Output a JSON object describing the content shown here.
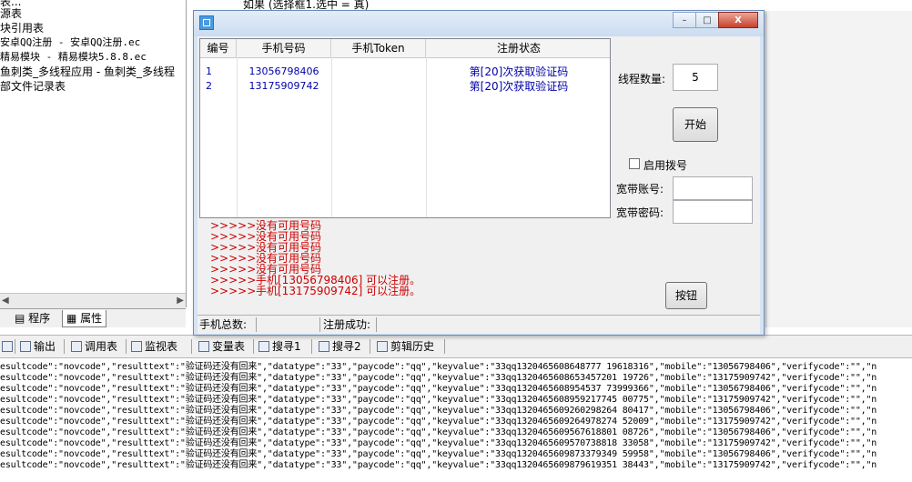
{
  "left_panel": {
    "tree_lines": [
      "表...",
      "源表",
      "块引用表",
      "安卓QQ注册 - 安卓QQ注册.ec",
      "精易模块 - 精易模块5.8.8.ec",
      "鱼刺类_多线程应用 - 鱼刺类_多线程",
      "部文件记录表"
    ],
    "tabs": [
      "程序",
      "属性"
    ]
  },
  "editor": {
    "code_fragment": "如果 (选择框1.选中 = 真)"
  },
  "dialog": {
    "window_controls": {
      "minimize": "–",
      "maximize": "□",
      "close": "X"
    },
    "table": {
      "columns": [
        "编号",
        "手机号码",
        "手机Token",
        "注册状态"
      ],
      "rows": [
        {
          "id": "1",
          "phone": "13056798406",
          "token": "",
          "status": "第[20]次获取验证码"
        },
        {
          "id": "2",
          "phone": "13175909742",
          "token": "",
          "status": "第[20]次获取验证码"
        }
      ]
    },
    "log_prefix": ">>>>>",
    "log_lines": [
      "没有可用号码",
      "没有可用号码",
      "没有可用号码",
      "没有可用号码",
      "没有可用号码",
      "手机[13056798406] 可以注册。",
      "手机[13175909742] 可以注册。"
    ],
    "status_bar": {
      "total_label": "手机总数:",
      "success_label": "注册成功:"
    },
    "panel": {
      "thread_label": "线程数量:",
      "thread_value": "5",
      "start_button": "开始",
      "dial_checkbox_label": "启用拨号",
      "dial_checked": false,
      "account_label": "宽带账号:",
      "account_value": "",
      "password_label": "宽带密码:",
      "password_value": "",
      "button_label": "按钮"
    }
  },
  "bottom_toolbar": {
    "items": [
      "输出",
      "调用表",
      "监视表",
      "变量表",
      "搜寻1",
      "搜寻2",
      "剪辑历史"
    ]
  },
  "output_lines": [
    "esultcode\":\"novcode\",\"resulttext\":\"验证码还没有回来\",\"datatype\":\"33\",\"paycode\":\"qq\",\"keyvalue\":\"33qq1320465608648777 19618316\",\"mobile\":\"13056798406\",\"verifycode\":\"\",\"n",
    "esultcode\":\"novcode\",\"resulttext\":\"验证码还没有回来\",\"datatype\":\"33\",\"paycode\":\"qq\",\"keyvalue\":\"33qq1320465608653457201 19726\",\"mobile\":\"13175909742\",\"verifycode\":\"\",\"n",
    "esultcode\":\"novcode\",\"resulttext\":\"验证码还没有回来\",\"datatype\":\"33\",\"paycode\":\"qq\",\"keyvalue\":\"33qq1320465608954537 73999366\",\"mobile\":\"13056798406\",\"verifycode\":\"\",\"n",
    "esultcode\":\"novcode\",\"resulttext\":\"验证码还没有回来\",\"datatype\":\"33\",\"paycode\":\"qq\",\"keyvalue\":\"33qq1320465608959217745 00775\",\"mobile\":\"13175909742\",\"verifycode\":\"\",\"n",
    "esultcode\":\"novcode\",\"resulttext\":\"验证码还没有回来\",\"datatype\":\"33\",\"paycode\":\"qq\",\"keyvalue\":\"33qq1320465609260298264 80417\",\"mobile\":\"13056798406\",\"verifycode\":\"\",\"n",
    "esultcode\":\"novcode\",\"resulttext\":\"验证码还没有回来\",\"datatype\":\"33\",\"paycode\":\"qq\",\"keyvalue\":\"33qq1320465609264978274 52009\",\"mobile\":\"13175909742\",\"verifycode\":\"\",\"n",
    "esultcode\":\"novcode\",\"resulttext\":\"验证码还没有回来\",\"datatype\":\"33\",\"paycode\":\"qq\",\"keyvalue\":\"33qq1320465609567618801 08726\",\"mobile\":\"13056798406\",\"verifycode\":\"\",\"n",
    "esultcode\":\"novcode\",\"resulttext\":\"验证码还没有回来\",\"datatype\":\"33\",\"paycode\":\"qq\",\"keyvalue\":\"33qq1320465609570738818 33058\",\"mobile\":\"13175909742\",\"verifycode\":\"\",\"n",
    "esultcode\":\"novcode\",\"resulttext\":\"验证码还没有回来\",\"datatype\":\"33\",\"paycode\":\"qq\",\"keyvalue\":\"33qq1320465609873379349 59958\",\"mobile\":\"13056798406\",\"verifycode\":\"\",\"n",
    "esultcode\":\"novcode\",\"resulttext\":\"验证码还没有回来\",\"datatype\":\"33\",\"paycode\":\"qq\",\"keyvalue\":\"33qq1320465609879619351 38443\",\"mobile\":\"13175909742\",\"verifycode\":\"\",\"n"
  ]
}
